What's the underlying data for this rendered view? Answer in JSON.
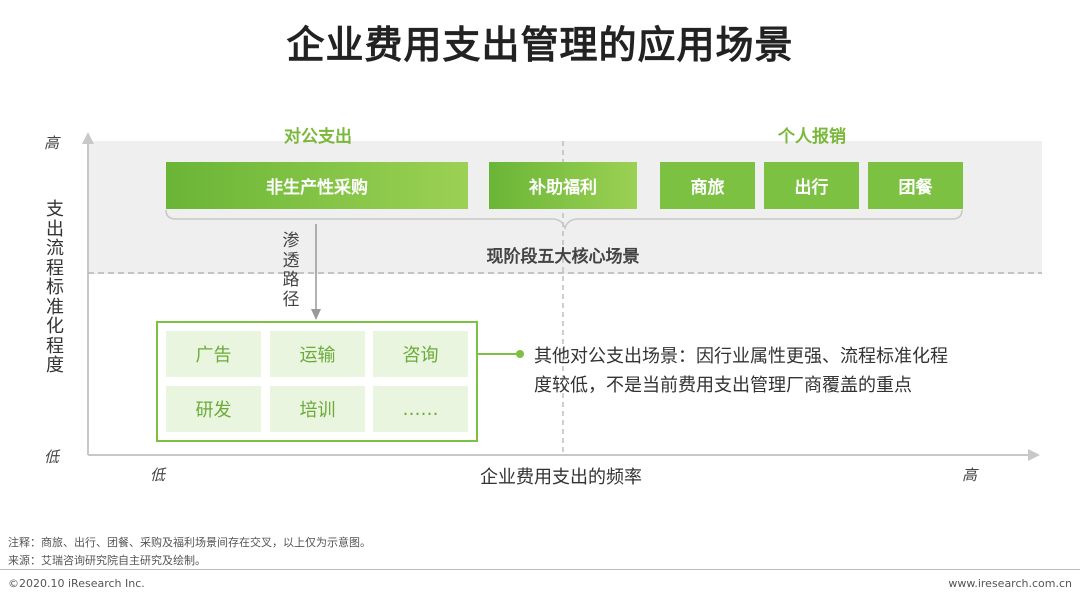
{
  "title": "企业费用支出管理的应用场景",
  "categories": {
    "public": "对公支出",
    "personal": "个人报销"
  },
  "core_scenes": [
    "非生产性采购",
    "补助福利",
    "商旅",
    "出行",
    "团餐"
  ],
  "core_label": "现阶段五大核心场景",
  "path_label": "渗透路径",
  "y_axis": {
    "label": "支出流程标准化程度",
    "high": "高",
    "low": "低"
  },
  "x_axis": {
    "label": "企业费用支出的频率",
    "low": "低",
    "high": "高"
  },
  "other_scenes": [
    "广告",
    "运输",
    "咨询",
    "研发",
    "培训",
    "……"
  ],
  "other_note": "其他对公支出场景：因行业属性更强、流程标准化程度较低，不是当前费用支出管理厂商覆盖的重点",
  "footer": {
    "note": "注释：商旅、出行、团餐、采购及福利场景间存在交叉，以上仅为示意图。",
    "source": "来源：艾瑞咨询研究院自主研究及绘制。",
    "copyright": "©2020.10 iResearch Inc.",
    "website": "www.iresearch.com.cn"
  },
  "colors": {
    "accent_green": "#7cc142",
    "light_green": "#eaf5df",
    "band_gray": "#efefef"
  }
}
